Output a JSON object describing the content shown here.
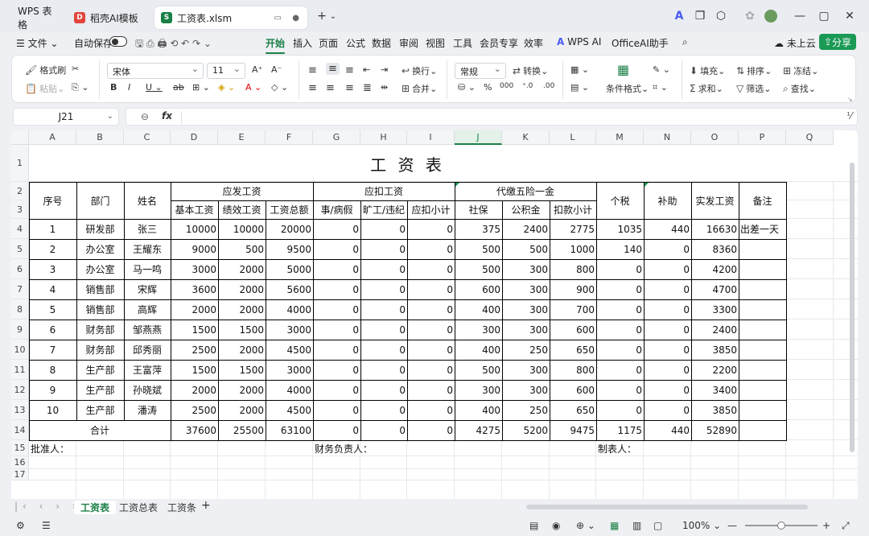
{
  "tabs": [
    {
      "label": "WPS 表格",
      "icon": "wps-icon"
    },
    {
      "label": "稻壳AI模板",
      "icon": "docer-icon"
    },
    {
      "label": "工资表.xlsm",
      "icon": "spreadsheet-icon"
    }
  ],
  "menu": {
    "file": "文件",
    "autosave": "自动保存",
    "items": [
      "开始",
      "插入",
      "页面",
      "公式",
      "数据",
      "审阅",
      "视图",
      "工具",
      "会员专享",
      "效率",
      "WPS AI",
      "OfficeAI助手"
    ],
    "cloud": "未上云",
    "share": "分享"
  },
  "ribbon": {
    "format_painter": "格式刷",
    "paste": "粘贴",
    "font": "宋体",
    "font_size": "11",
    "wrap": "换行",
    "merge": "合并",
    "number_format": "常规",
    "convert": "转换",
    "conditional": "条件格式",
    "fill": "填充",
    "sum": "求和",
    "sort": "排序",
    "filter": "筛选",
    "freeze": "冻结",
    "find": "查找"
  },
  "formula_bar": {
    "name_box": "J21",
    "fx": "fx",
    "value": ""
  },
  "columns": [
    "A",
    "B",
    "C",
    "D",
    "E",
    "F",
    "G",
    "H",
    "I",
    "J",
    "K",
    "L",
    "M",
    "N",
    "O",
    "P",
    "Q"
  ],
  "rows": [
    "1",
    "2",
    "3",
    "4",
    "5",
    "6",
    "7",
    "8",
    "9",
    "10",
    "11",
    "12",
    "13",
    "14",
    "15",
    "16",
    "17"
  ],
  "selected_cell": "J21",
  "table": {
    "title": "工 资 表",
    "headers": {
      "seq": "序号",
      "dept": "部门",
      "name": "姓名",
      "pay_group": "应发工资",
      "base": "基本工资",
      "perf": "绩效工资",
      "total": "工资总额",
      "deduct_group": "应扣工资",
      "leave": "事/病假",
      "absent": "旷工/违纪",
      "deduct_sub": "应扣小计",
      "insure_group": "代缴五险一金",
      "social": "社保",
      "fund": "公积金",
      "insure_sub": "扣款小计",
      "tax": "个税",
      "subsidy": "补助",
      "net": "实发工资",
      "note": "备注"
    },
    "rows": [
      [
        "1",
        "研发部",
        "张三",
        "10000",
        "10000",
        "20000",
        "0",
        "0",
        "0",
        "375",
        "2400",
        "2775",
        "1035",
        "440",
        "16630",
        "出差一天"
      ],
      [
        "2",
        "办公室",
        "王耀东",
        "9000",
        "500",
        "9500",
        "0",
        "0",
        "0",
        "500",
        "500",
        "1000",
        "140",
        "0",
        "8360",
        ""
      ],
      [
        "3",
        "办公室",
        "马一鸣",
        "3000",
        "2000",
        "5000",
        "0",
        "0",
        "0",
        "500",
        "300",
        "800",
        "0",
        "0",
        "4200",
        ""
      ],
      [
        "4",
        "销售部",
        "宋辉",
        "3600",
        "2000",
        "5600",
        "0",
        "0",
        "0",
        "600",
        "300",
        "900",
        "0",
        "0",
        "4700",
        ""
      ],
      [
        "5",
        "销售部",
        "高辉",
        "2000",
        "2000",
        "4000",
        "0",
        "0",
        "0",
        "400",
        "300",
        "700",
        "0",
        "0",
        "3300",
        ""
      ],
      [
        "6",
        "财务部",
        "邹燕燕",
        "1500",
        "1500",
        "3000",
        "0",
        "0",
        "0",
        "300",
        "300",
        "600",
        "0",
        "0",
        "2400",
        ""
      ],
      [
        "7",
        "财务部",
        "邱秀丽",
        "2500",
        "2000",
        "4500",
        "0",
        "0",
        "0",
        "400",
        "250",
        "650",
        "0",
        "0",
        "3850",
        ""
      ],
      [
        "8",
        "生产部",
        "王富萍",
        "1500",
        "1500",
        "3000",
        "0",
        "0",
        "0",
        "500",
        "300",
        "800",
        "0",
        "0",
        "2200",
        ""
      ],
      [
        "9",
        "生产部",
        "孙晓斌",
        "2000",
        "2000",
        "4000",
        "0",
        "0",
        "0",
        "300",
        "300",
        "600",
        "0",
        "0",
        "3400",
        ""
      ],
      [
        "10",
        "生产部",
        "潘涛",
        "2500",
        "2000",
        "4500",
        "0",
        "0",
        "0",
        "400",
        "250",
        "650",
        "0",
        "0",
        "3850",
        ""
      ]
    ],
    "total": {
      "label": "合计",
      "values": [
        "37600",
        "25500",
        "63100",
        "0",
        "0",
        "0",
        "4275",
        "5200",
        "9475",
        "1175",
        "440",
        "52890",
        ""
      ]
    },
    "footer": {
      "approver": "批准人：",
      "finance": "财务负责人：",
      "maker": "制表人："
    }
  },
  "sheet_tabs": [
    "工资表",
    "工资总表",
    "工资条"
  ],
  "status": {
    "zoom": "100%"
  }
}
